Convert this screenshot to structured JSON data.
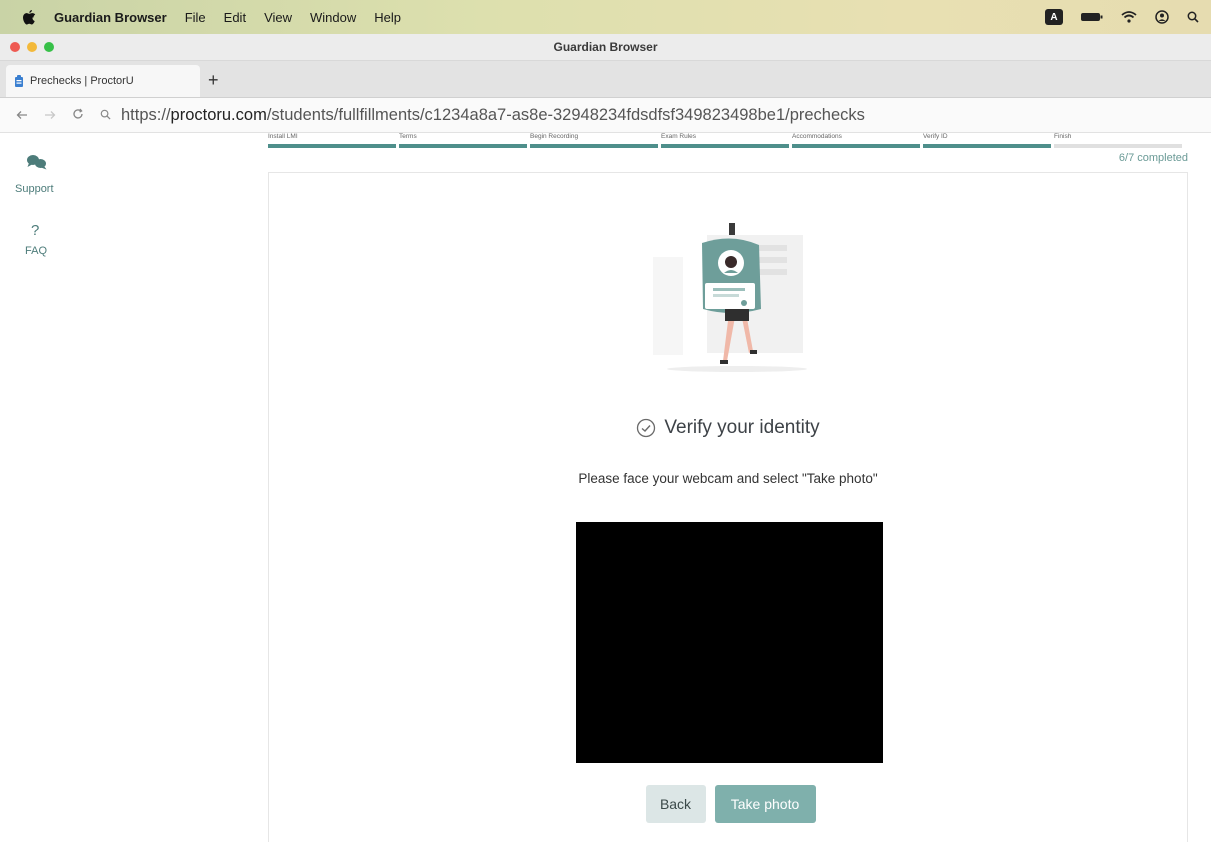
{
  "menubar": {
    "app_name": "Guardian Browser",
    "items": [
      "File",
      "Edit",
      "View",
      "Window",
      "Help"
    ],
    "status_icons": [
      "keyboard-layout-icon",
      "battery-icon",
      "wifi-icon",
      "user-icon",
      "search-icon"
    ],
    "keyboard_badge": "A"
  },
  "window": {
    "title": "Guardian Browser"
  },
  "tab": {
    "title": "Prechecks | ProctorU",
    "new_tab": "+"
  },
  "address": {
    "url_prefix": "https://",
    "url_domain": "proctoru.com",
    "url_path": "/students/fullfillments/c1234a8a7-as8e-32948234fdsdfsf349823498be1/prechecks"
  },
  "sidebar": {
    "support_label": "Support",
    "faq_glyph": "?",
    "faq_label": "FAQ"
  },
  "steps": [
    {
      "label": "Install LMI",
      "status": "done"
    },
    {
      "label": "Terms",
      "status": "done"
    },
    {
      "label": "Begin Recording",
      "status": "done"
    },
    {
      "label": "Exam Rules",
      "status": "done"
    },
    {
      "label": "Accommodations",
      "status": "done"
    },
    {
      "label": "Verify ID",
      "status": "done"
    },
    {
      "label": "Finish",
      "status": "pending"
    }
  ],
  "progress_text": "6/7 completed",
  "main": {
    "heading": "Verify your identity",
    "instruction": "Please face your webcam and select \"Take photo\"",
    "back_label": "Back",
    "take_photo_label": "Take photo"
  },
  "colors": {
    "accent": "#4e8f8b",
    "primary_button": "#7fb0ac",
    "secondary_button": "#dce6e6"
  }
}
